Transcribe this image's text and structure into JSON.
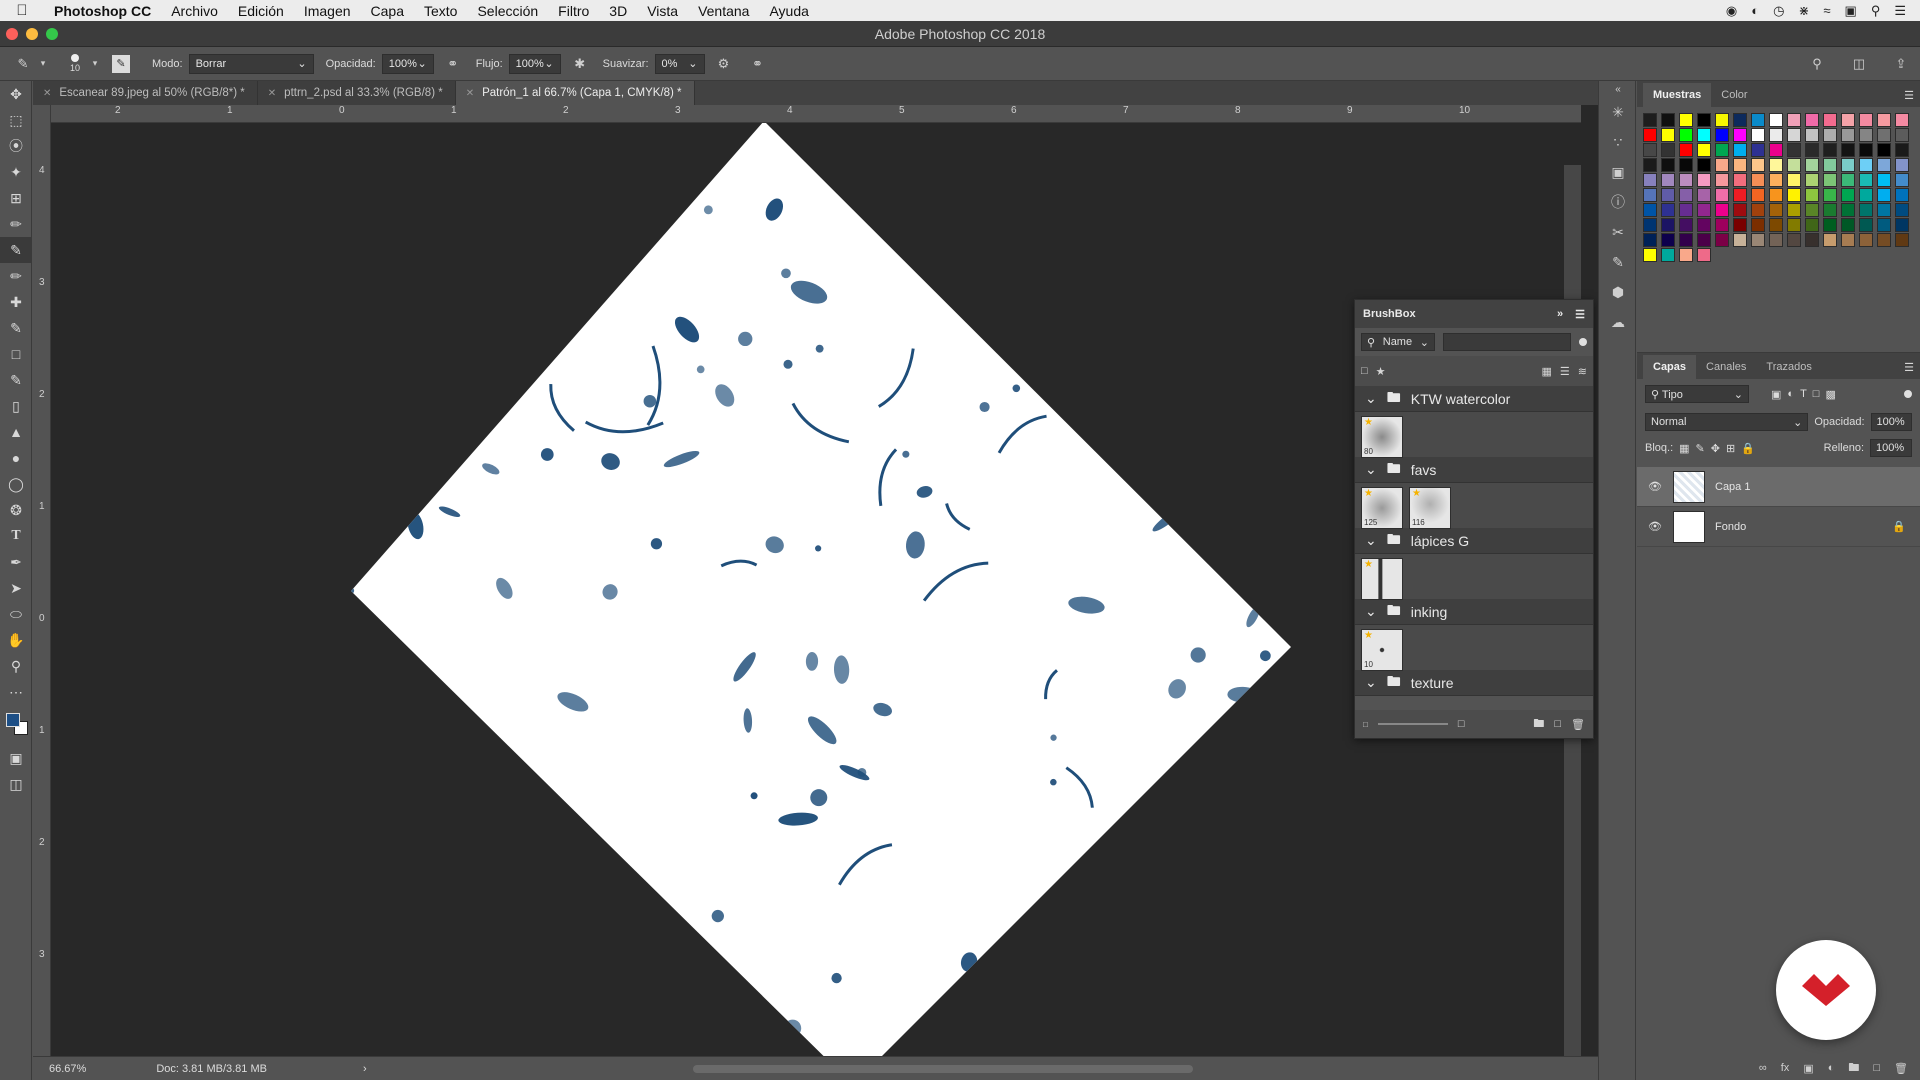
{
  "menubar": {
    "app_name": "Photoshop CC",
    "items": [
      "Archivo",
      "Edición",
      "Imagen",
      "Capa",
      "Texto",
      "Selección",
      "Filtro",
      "3D",
      "Vista",
      "Ventana",
      "Ayuda"
    ]
  },
  "window": {
    "title": "Adobe Photoshop CC 2018"
  },
  "options": {
    "brush_size": "10",
    "mode_label": "Modo:",
    "mode_value": "Borrar",
    "opacity_label": "Opacidad:",
    "opacity_value": "100%",
    "flow_label": "Flujo:",
    "flow_value": "100%",
    "smoothing_label": "Suavizar:",
    "smoothing_value": "0%"
  },
  "tabs": [
    {
      "label": "Escanear 89.jpeg al 50% (RGB/8*) *"
    },
    {
      "label": "pttrn_2.psd al 33.3% (RGB/8) *"
    },
    {
      "label": "Patrón_1 al 66.7% (Capa 1, CMYK/8) *"
    }
  ],
  "rulers": {
    "top": [
      "2",
      "1",
      "0",
      "1",
      "2",
      "3",
      "4",
      "5",
      "6",
      "7",
      "8",
      "9",
      "10"
    ],
    "left": [
      "4",
      "3",
      "2",
      "1",
      "0",
      "1",
      "2",
      "3"
    ]
  },
  "status": {
    "zoom": "66.67%",
    "doc": "Doc: 3.81 MB/3.81 MB"
  },
  "brushbox": {
    "title": "BrushBox",
    "search_label": "Name",
    "folders": [
      {
        "name": "KTW watercolor",
        "thumbs": [
          "80"
        ]
      },
      {
        "name": "favs",
        "thumbs": [
          "125",
          "116"
        ]
      },
      {
        "name": "lápices G",
        "thumbs": [
          ""
        ]
      },
      {
        "name": "inking",
        "thumbs": [
          "10"
        ]
      },
      {
        "name": "texture",
        "thumbs": []
      }
    ]
  },
  "panels": {
    "swatch_tabs": [
      "Muestras",
      "Color"
    ],
    "layer_tabs": [
      "Capas",
      "Canales",
      "Trazados"
    ],
    "filter_kind": "Tipo",
    "blend_mode": "Normal",
    "opacity_label": "Opacidad:",
    "opacity_value": "100%",
    "lock_label": "Bloq.:",
    "fill_label": "Relleno:",
    "fill_value": "100%",
    "layers": [
      {
        "name": "Capa 1",
        "selected": true
      },
      {
        "name": "Fondo",
        "selected": false
      }
    ]
  },
  "colors": {
    "pattern_ink": "#1f4e7a",
    "foreground": "#1d4f86",
    "accent_watermark": "#d4202a"
  },
  "swatch_colors": [
    "#1e1e1e",
    "#101010",
    "#ffff00",
    "#000000",
    "#f6f600",
    "#0d2a5c",
    "#0a8ac9",
    "#ffffff",
    "#f0a0b8",
    "#f06aa8",
    "#f36b8f",
    "#f4a2a8",
    "#f38aa0",
    "#f59aa0",
    "#f48aa2",
    "#ff0000",
    "#ffff00",
    "#00ff00",
    "#00ffff",
    "#0000ff",
    "#ff00ff",
    "#ffffff",
    "#ebebeb",
    "#d6d6d6",
    "#c2c2c2",
    "#adadad",
    "#999999",
    "#858585",
    "#707070",
    "#5c5c5c",
    "#474747",
    "#333333",
    "#ff0000",
    "#ffff00",
    "#00a651",
    "#00aeef",
    "#2e3192",
    "#ec008c",
    "#333333",
    "#2a2a2a",
    "#1f1f1f",
    "#141414",
    "#0a0a0a",
    "#000000",
    "#1a1a1a",
    "#1b1b1b",
    "#0f0f0f",
    "#080808",
    "#000000",
    "#f9a88a",
    "#fbb57f",
    "#fdc68a",
    "#fff79a",
    "#c4df9b",
    "#a3d39c",
    "#82ca9c",
    "#7accc8",
    "#6dcff6",
    "#7da7d9",
    "#8393ca",
    "#8781bd",
    "#a187be",
    "#bc8dbf",
    "#f49ac2",
    "#f6989d",
    "#f26d7d",
    "#f68e56",
    "#fbaf5d",
    "#fff568",
    "#acd372",
    "#7cc576",
    "#3bb878",
    "#1abbb4",
    "#00bff3",
    "#438ccb",
    "#5574b9",
    "#605ca8",
    "#855fa8",
    "#a763a8",
    "#f06ea9",
    "#ed1c24",
    "#f26522",
    "#f7941d",
    "#fff200",
    "#8dc63f",
    "#39b54a",
    "#00a651",
    "#00a99d",
    "#00aeef",
    "#0072bc",
    "#0054a6",
    "#2e3192",
    "#662d91",
    "#92278f",
    "#ec008c",
    "#9e0b0f",
    "#a0410d",
    "#a36209",
    "#aba000",
    "#598527",
    "#1a7b30",
    "#007236",
    "#00746b",
    "#0076a3",
    "#004b80",
    "#003471",
    "#1b1464",
    "#440e62",
    "#630460",
    "#9e005d",
    "#790000",
    "#7b2e00",
    "#7d4900",
    "#827b00",
    "#406618",
    "#005e20",
    "#005826",
    "#005952",
    "#005b7f",
    "#003663",
    "#002157",
    "#0d004c",
    "#32004b",
    "#4b0049",
    "#7b0046",
    "#c7b299",
    "#998675",
    "#736357",
    "#534741",
    "#37302d",
    "#c69c6d",
    "#a67c52",
    "#8c6239",
    "#754c24",
    "#603913",
    "#ffff00",
    "#00a99d",
    "#f9a88a",
    "#ee6a89"
  ]
}
